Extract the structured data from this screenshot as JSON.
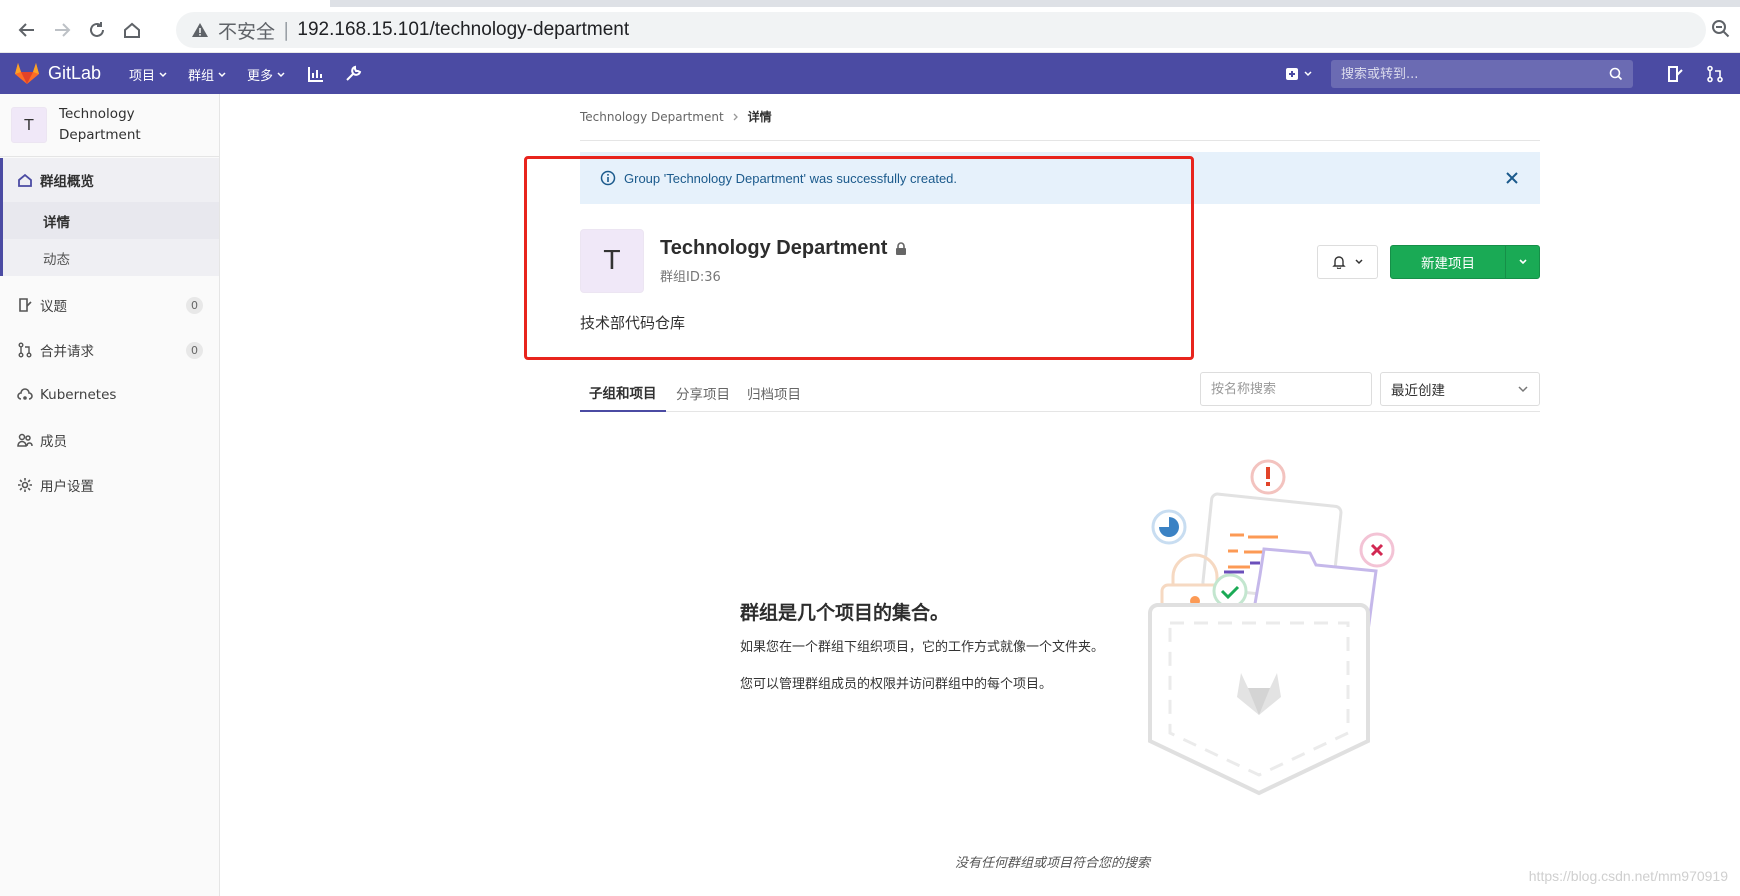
{
  "browser": {
    "security_label": "不安全",
    "separator": "|",
    "url": "192.168.15.101/technology-department"
  },
  "header": {
    "brand": "GitLab",
    "menu_projects": "项目",
    "menu_groups": "群组",
    "menu_more": "更多",
    "search_placeholder": "搜索或转到..."
  },
  "sidebar": {
    "avatar_letter": "T",
    "group_name_line1": "Technology",
    "group_name_line2": "Department",
    "overview": "群组概览",
    "details": "详情",
    "activity": "动态",
    "issues": "议题",
    "issues_count": "0",
    "merge_requests": "合并请求",
    "merge_requests_count": "0",
    "kubernetes": "Kubernetes",
    "members": "成员",
    "settings": "用户设置"
  },
  "breadcrumb": {
    "parent": "Technology Department",
    "current": "详情"
  },
  "alert": {
    "message": "Group 'Technology Department' was successfully created."
  },
  "group": {
    "avatar_letter": "T",
    "title": "Technology Department",
    "id_label": "群组ID:36",
    "description": "技术部代码仓库"
  },
  "actions": {
    "new_project": "新建项目"
  },
  "tabs": {
    "subgroups": "子组和项目",
    "shared": "分享项目",
    "archived": "归档项目"
  },
  "filter": {
    "placeholder": "按名称搜索",
    "sort": "最近创建"
  },
  "empty_state": {
    "title": "群组是几个项目的集合。",
    "line1": "如果您在一个群组下组织项目，它的工作方式就像一个文件夹。",
    "line2": "您可以管理群组成员的权限并访问群组中的每个项目。",
    "no_results": "没有任何群组或项目符合您的搜索"
  },
  "watermark": "https://blog.csdn.net/mm970919",
  "colors": {
    "header": "#4b4ba3",
    "primary_green": "#1aaa55",
    "alert_bg": "#e6f1fb",
    "annotation_red": "#e8241d"
  }
}
